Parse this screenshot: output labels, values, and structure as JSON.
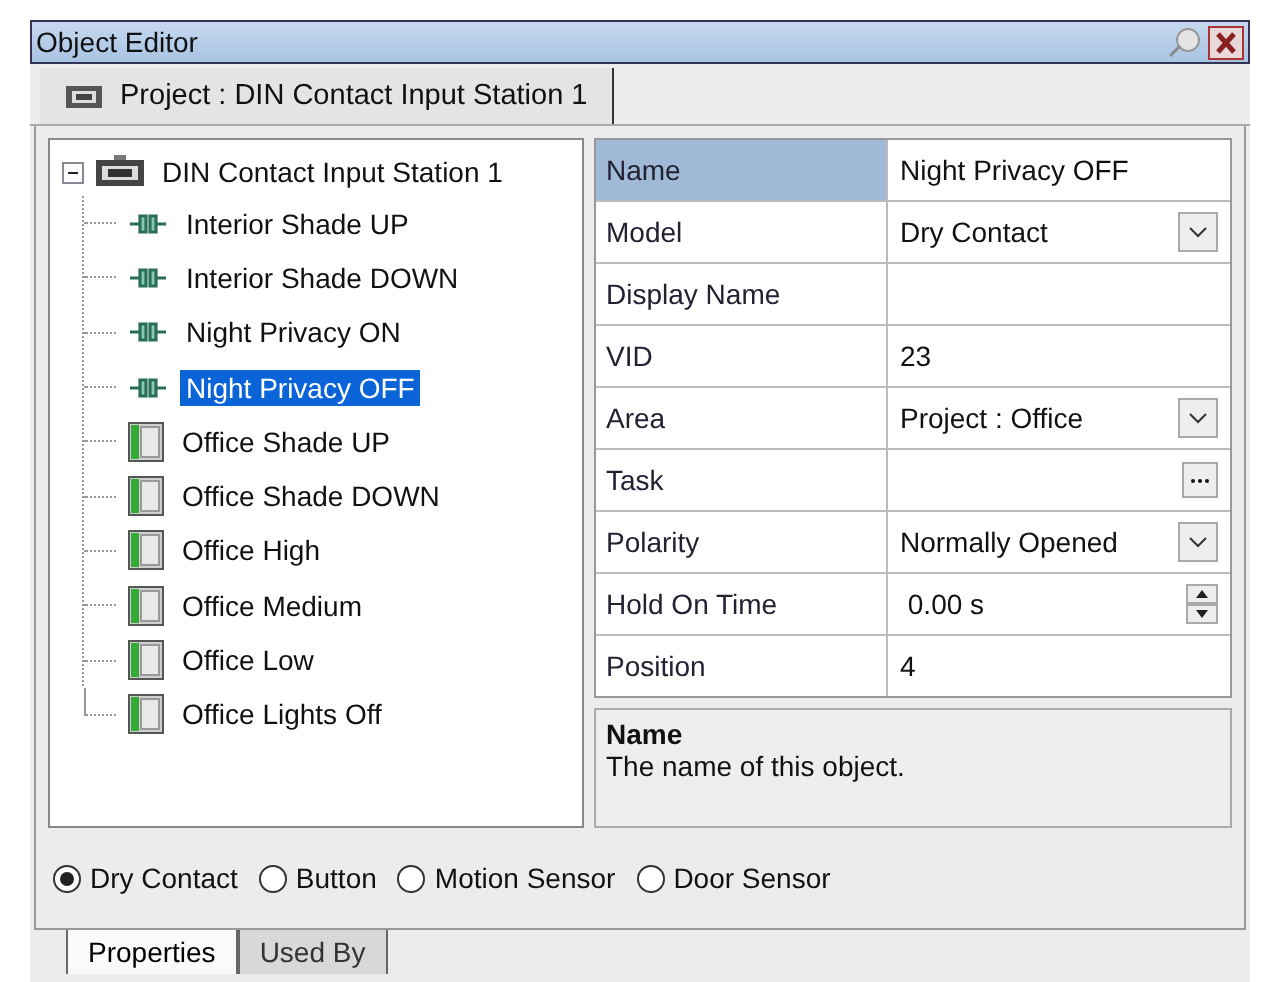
{
  "window": {
    "title": "Object Editor"
  },
  "document_tab": {
    "label": "Project : DIN Contact Input Station 1"
  },
  "tree": {
    "label": "DIN Contact Input Station 1",
    "expanded": true,
    "children": [
      {
        "label": "Interior Shade UP",
        "kind": "contact",
        "selected": false
      },
      {
        "label": "Interior Shade DOWN",
        "kind": "contact",
        "selected": false
      },
      {
        "label": "Night Privacy ON",
        "kind": "contact",
        "selected": false
      },
      {
        "label": "Night Privacy OFF",
        "kind": "contact",
        "selected": true
      },
      {
        "label": "Office Shade UP",
        "kind": "switch",
        "selected": false
      },
      {
        "label": "Office Shade DOWN",
        "kind": "switch",
        "selected": false
      },
      {
        "label": "Office High",
        "kind": "switch",
        "selected": false
      },
      {
        "label": "Office Medium",
        "kind": "switch",
        "selected": false
      },
      {
        "label": "Office Low",
        "kind": "switch",
        "selected": false
      },
      {
        "label": "Office Lights Off",
        "kind": "switch",
        "selected": false
      }
    ]
  },
  "properties": [
    {
      "name": "Name",
      "value": "Night Privacy OFF",
      "kind": "text",
      "selected": true
    },
    {
      "name": "Model",
      "value": "Dry Contact",
      "kind": "dropdown",
      "selected": false
    },
    {
      "name": "Display Name",
      "kind": "text",
      "selected": false
    },
    {
      "name": "VID",
      "value": "23",
      "kind": "text",
      "selected": false
    },
    {
      "name": "Area",
      "value": "Project : Office",
      "kind": "dropdown",
      "selected": false
    },
    {
      "name": "Task",
      "kind": "ellipsis",
      "selected": false
    },
    {
      "name": "Polarity",
      "value": "Normally Opened",
      "kind": "dropdown",
      "selected": false
    },
    {
      "name": "Hold On Time",
      "value": " 0.00 s",
      "kind": "spin",
      "selected": false
    },
    {
      "name": "Position",
      "value": "4",
      "kind": "text",
      "selected": false
    }
  ],
  "description": {
    "title": "Name",
    "text": "The name of this object."
  },
  "types": [
    {
      "label": "Dry Contact",
      "selected": true
    },
    {
      "label": "Button",
      "selected": false
    },
    {
      "label": "Motion Sensor",
      "selected": false
    },
    {
      "label": "Door Sensor",
      "selected": false
    }
  ],
  "bottom_tabs": [
    {
      "label": "Properties",
      "selected": true
    },
    {
      "label": "Used By",
      "selected": false
    }
  ]
}
